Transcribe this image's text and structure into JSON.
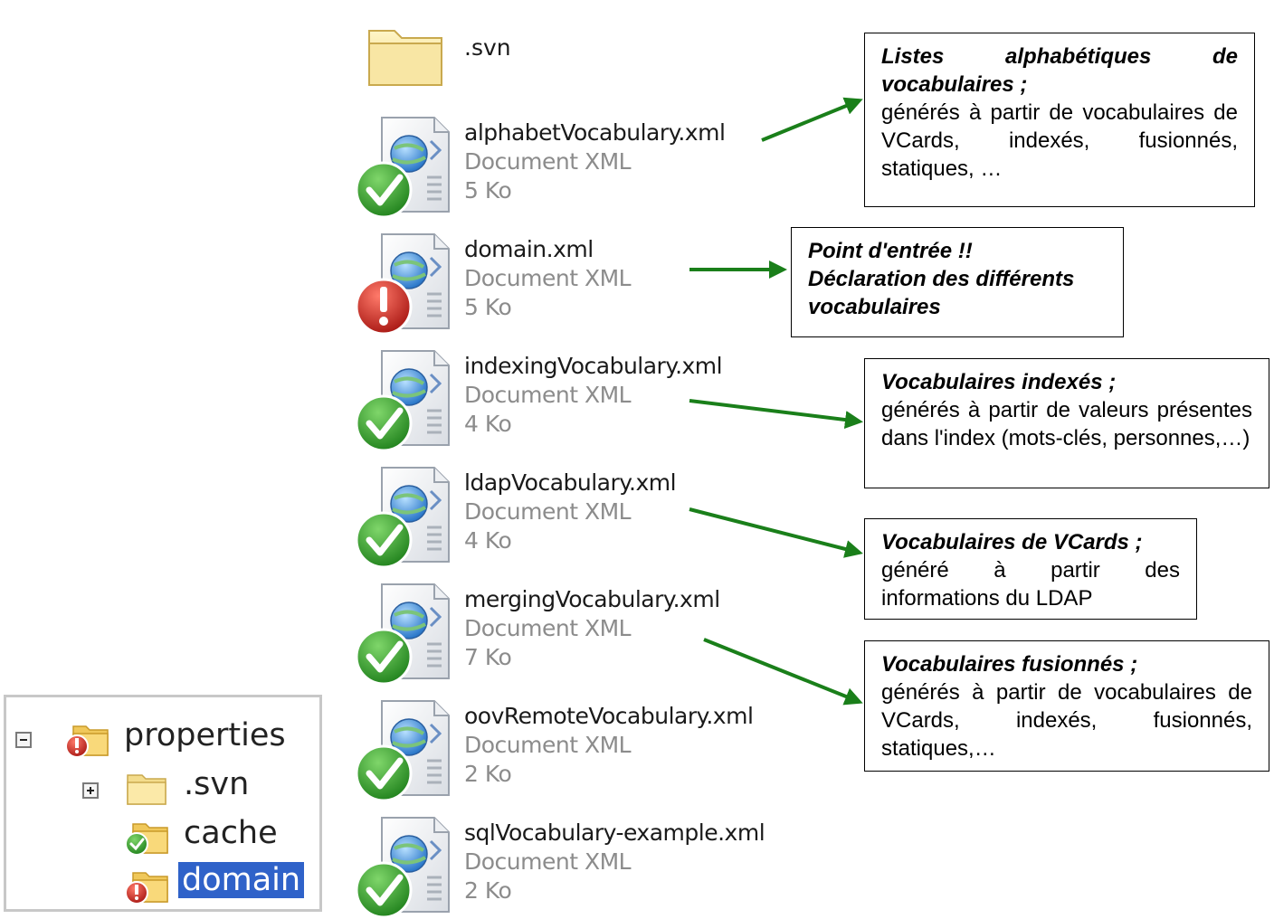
{
  "svn_folder": {
    "name": ".svn",
    "icon": "folder-icon"
  },
  "files": [
    {
      "name": "alphabetVocabulary.xml",
      "type": "Document XML",
      "size": "5 Ko",
      "status": "ok"
    },
    {
      "name": "domain.xml",
      "type": "Document XML",
      "size": "5 Ko",
      "status": "conflict"
    },
    {
      "name": "indexingVocabulary.xml",
      "type": "Document XML",
      "size": "4 Ko",
      "status": "ok"
    },
    {
      "name": "ldapVocabulary.xml",
      "type": "Document XML",
      "size": "4 Ko",
      "status": "ok"
    },
    {
      "name": "mergingVocabulary.xml",
      "type": "Document XML",
      "size": "7 Ko",
      "status": "ok"
    },
    {
      "name": "oovRemoteVocabulary.xml",
      "type": "Document XML",
      "size": "2 Ko",
      "status": "ok"
    },
    {
      "name": "sqlVocabulary-example.xml",
      "type": "Document XML",
      "size": "2 Ko",
      "status": "ok"
    }
  ],
  "annotations": {
    "alphabet": {
      "title": "Listes alphabétiques de vocabulaires ;",
      "desc": "générés à partir de vocabulaires de VCards, indexés, fusionnés, statiques, …"
    },
    "domain": {
      "line1": "Point d'entrée  !!",
      "line2": "Déclaration des différents vocabulaires"
    },
    "indexing": {
      "title": "Vocabulaires indexés ;",
      "desc": "générés à partir de valeurs présentes dans l'index (mots-clés, personnes,…)"
    },
    "ldap": {
      "title": "Vocabulaires de VCards ;",
      "desc": "généré à partir des informations du LDAP"
    },
    "merging": {
      "title": "Vocabulaires fusionnés ;",
      "desc": "générés à partir de vocabulaires de VCards, indexés, fusionnés, statiques,…"
    }
  },
  "tree": {
    "root": "properties",
    "children": [
      ".svn",
      "cache",
      "domain"
    ],
    "selected": "domain"
  },
  "colors": {
    "arrow": "#1a7f1a",
    "ok": "#3aa52c",
    "conflict": "#c8201c",
    "selection": "#2f62c9"
  }
}
